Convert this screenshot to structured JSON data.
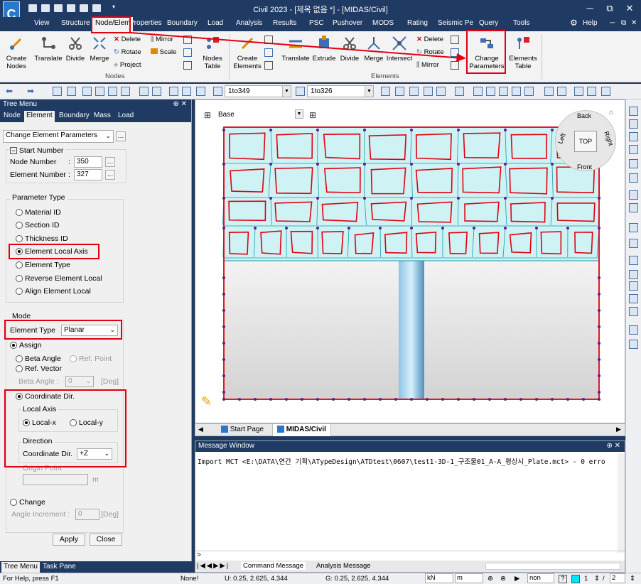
{
  "window": {
    "title": "Civil 2023 - [제목 없음 *] - [MIDAS/Civil]",
    "controls": [
      "─",
      "⧉",
      "✕"
    ],
    "inner_controls": [
      "─",
      "⧉",
      "✕"
    ]
  },
  "menu": {
    "items": [
      "View",
      "Structure",
      "Node/Elem",
      "Properties",
      "Boundary",
      "Load",
      "Analysis",
      "Results",
      "PSC",
      "Pushover",
      "MODS",
      "Rating",
      "Seismic Pe",
      "Query",
      "Tools"
    ],
    "active": "Node/Elem",
    "help": "Help"
  },
  "ribbon": {
    "nodes_group": {
      "label": "Nodes",
      "create": "Create\nNodes",
      "translate": "Translate",
      "divide": "Divide",
      "merge": "Merge",
      "delete": "Delete",
      "rotate": "Rotate",
      "project": "Project",
      "mirror": "Mirror",
      "scale": "Scale",
      "nodes_table": "Nodes\nTable"
    },
    "elements_group": {
      "label": "Elements",
      "create": "Create\nElements",
      "translate": "Translate",
      "extrude": "Extrude",
      "divide": "Divide",
      "merge": "Merge",
      "intersect": "Intersect",
      "delete": "Delete",
      "rotate": "Rotate",
      "mirror": "Mirror",
      "change_parameters": "Change\nParameters",
      "elements_table": "Elements\nTable"
    }
  },
  "toolbar": {
    "node_range": "1to349",
    "elem_range": "1to326"
  },
  "tree_menu": {
    "title": "Tree Menu",
    "pin": "⊕ ✕",
    "tabs": [
      "Node",
      "Element",
      "Boundary",
      "Mass",
      "Load"
    ],
    "active_tab": "Element",
    "function": "Change Element Parameters",
    "start_number": {
      "label": "Start Number",
      "node_label": "Node Number",
      "node_value": "350",
      "elem_label": "Element Number",
      "elem_value": "327"
    },
    "parameter_type": {
      "label": "Parameter Type",
      "options": [
        "Material ID",
        "Section ID",
        "Thickness ID",
        "Element Local Axis",
        "Element Type",
        "Reverse Element Local",
        "Align Element Local"
      ],
      "selected": "Element Local Axis"
    },
    "mode": {
      "label": "Mode",
      "element_type_label": "Element Type",
      "element_type_value": "Planar",
      "assign": "Assign",
      "beta_angle": "Beta Angle",
      "ref_point": "Ref. Point",
      "ref_vector": "Ref. Vector",
      "beta_angle_field_label": "Beta Angle :",
      "beta_angle_value": "0",
      "deg": "[Deg]",
      "coordinate_dir": "Coordinate Dir.",
      "local_axis_label": "Local Axis",
      "local_x": "Local-x",
      "local_y": "Local-y",
      "direction_label": "Direction",
      "coord_dir_label": "Coordinate Dir.",
      "coord_dir_value": "+Z",
      "origin_point": "Origin Point",
      "unit_m": "m",
      "change": "Change",
      "angle_increment": "Angle Increment :",
      "angle_increment_value": "0",
      "deg2": "[Deg]"
    },
    "apply": "Apply",
    "close": "Close",
    "bottom_tabs": [
      "Tree Menu",
      "Task Pane"
    ]
  },
  "viewport": {
    "view_label": "Base",
    "cube": {
      "back": "Back",
      "front": "Front",
      "top": "TOP",
      "left": "Left",
      "right": "Right"
    }
  },
  "doc_tabs": [
    "Start Page",
    "MIDAS/Civil"
  ],
  "message_window": {
    "title": "Message Window",
    "text": "Import MCT <E:\\DATA\\연간 기획\\ATypeDesign\\ATDtest\\0607\\test1-3D-1_구조물01_A-A_평상시_Plate.mct> - 0 erro",
    "prompt": ">",
    "tabs": [
      "Command Message",
      "Analysis Message"
    ]
  },
  "status": {
    "help": "For Help, press F1",
    "none": "None!",
    "u_coord": "U: 0.25, 2.625, 4.344",
    "g_coord": "G: 0.25, 2.625, 4.344",
    "force_unit": "kN",
    "length_unit": "m",
    "non": "non",
    "page": "1",
    "page2": "2"
  },
  "colors": {
    "accent": "#1f3b63",
    "highlight": "#e1000f",
    "mesh_fill": "#cff2f5",
    "mesh_line": "#1a9aa6",
    "node": "#5b1e8b"
  }
}
